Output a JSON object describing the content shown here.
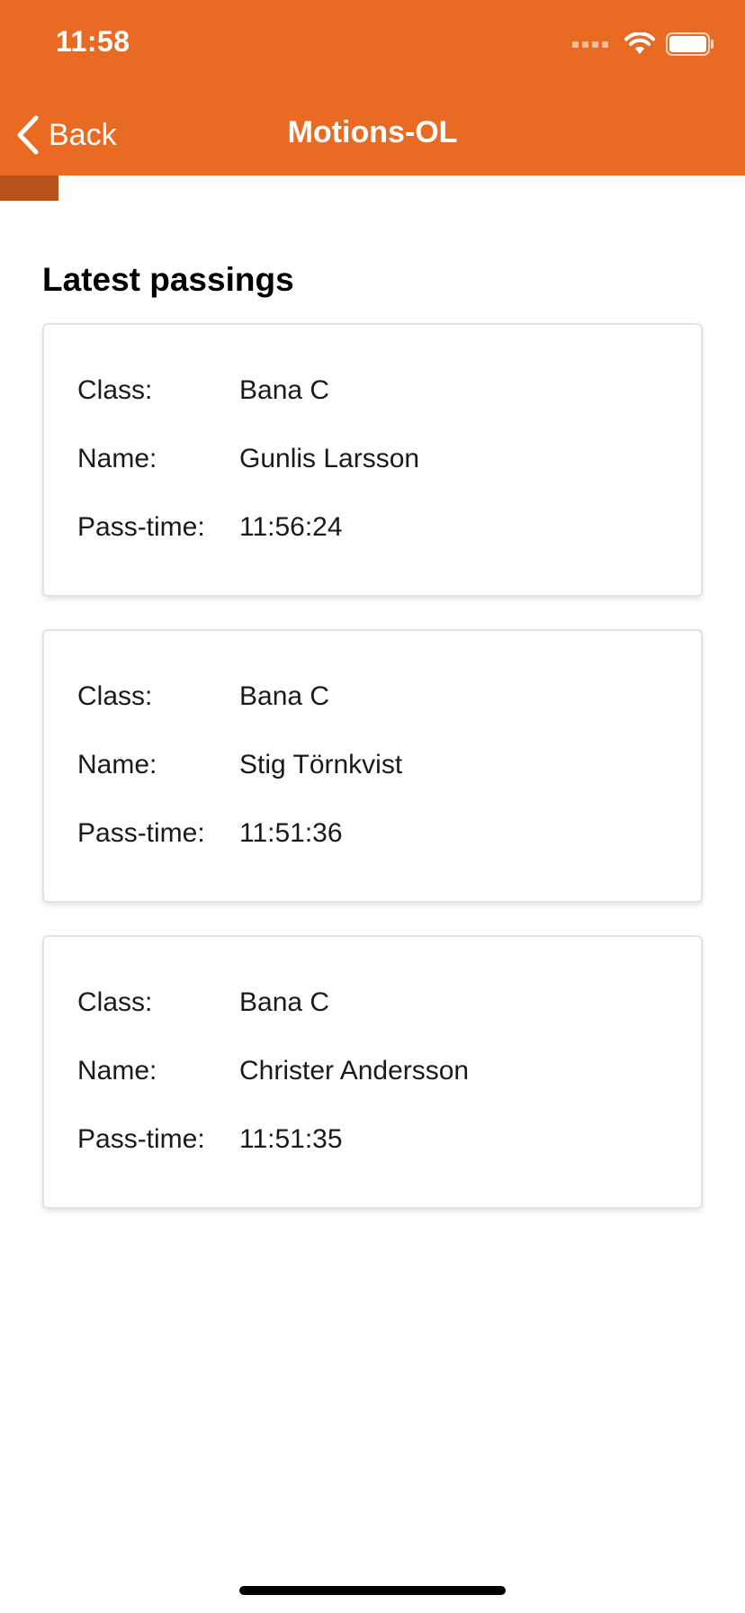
{
  "status_bar": {
    "time": "11:58"
  },
  "nav": {
    "back_label": "Back",
    "title": "Motions-OL"
  },
  "progress": {
    "fraction": 0.078
  },
  "section_title": "Latest passings",
  "labels": {
    "class": "Class:",
    "name": "Name:",
    "pass_time": "Pass-time:"
  },
  "passings": [
    {
      "class": "Bana C",
      "name": "Gunlis Larsson",
      "pass_time": "11:56:24"
    },
    {
      "class": "Bana C",
      "name": "Stig Törnkvist",
      "pass_time": "11:51:36"
    },
    {
      "class": "Bana C",
      "name": "Christer Andersson",
      "pass_time": "11:51:35"
    }
  ],
  "colors": {
    "header": "#E96B23",
    "progress": "#B8521A"
  }
}
